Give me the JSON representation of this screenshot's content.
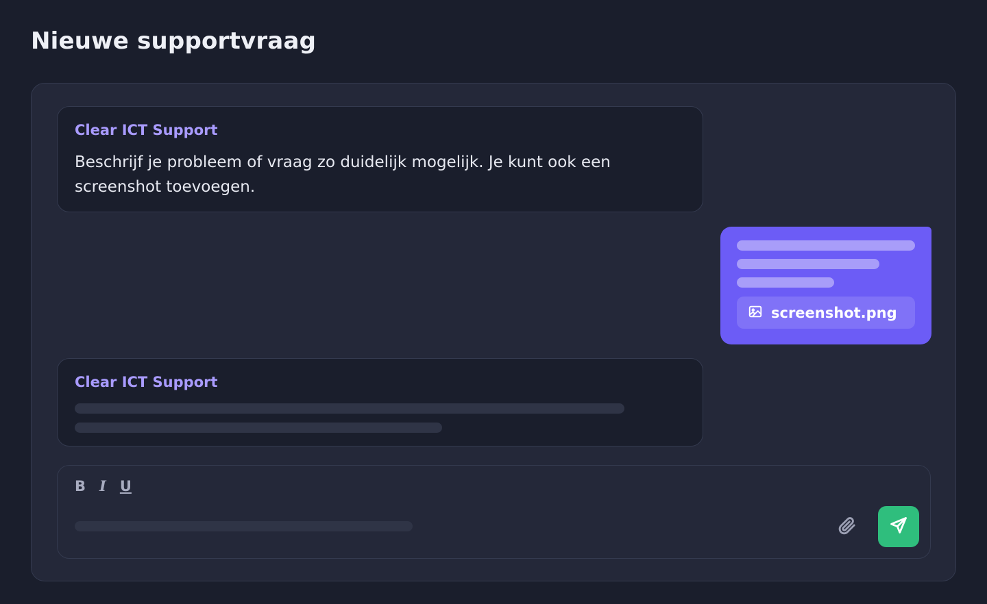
{
  "page": {
    "title": "Nieuwe supportvraag"
  },
  "messages": [
    {
      "role": "support",
      "sender": "Clear ICT Support",
      "text": "Beschrijf je probleem of vraag zo duidelijk mogelijk. Je kunt ook een screenshot toevoegen."
    },
    {
      "role": "user",
      "attachment": {
        "name": "screenshot.png",
        "icon": "image-icon"
      }
    },
    {
      "role": "support",
      "sender": "Clear ICT Support",
      "typing": true
    }
  ],
  "composer": {
    "format_buttons": {
      "bold": "B",
      "italic": "I",
      "underline": "U"
    },
    "attach_icon": "paperclip-icon",
    "send_icon": "send-icon"
  },
  "colors": {
    "background": "#1a1e2c",
    "panel": "#242839",
    "accent_purple": "#6c5cf6",
    "sender_name": "#a99bff",
    "send_green": "#2fbe7d"
  }
}
